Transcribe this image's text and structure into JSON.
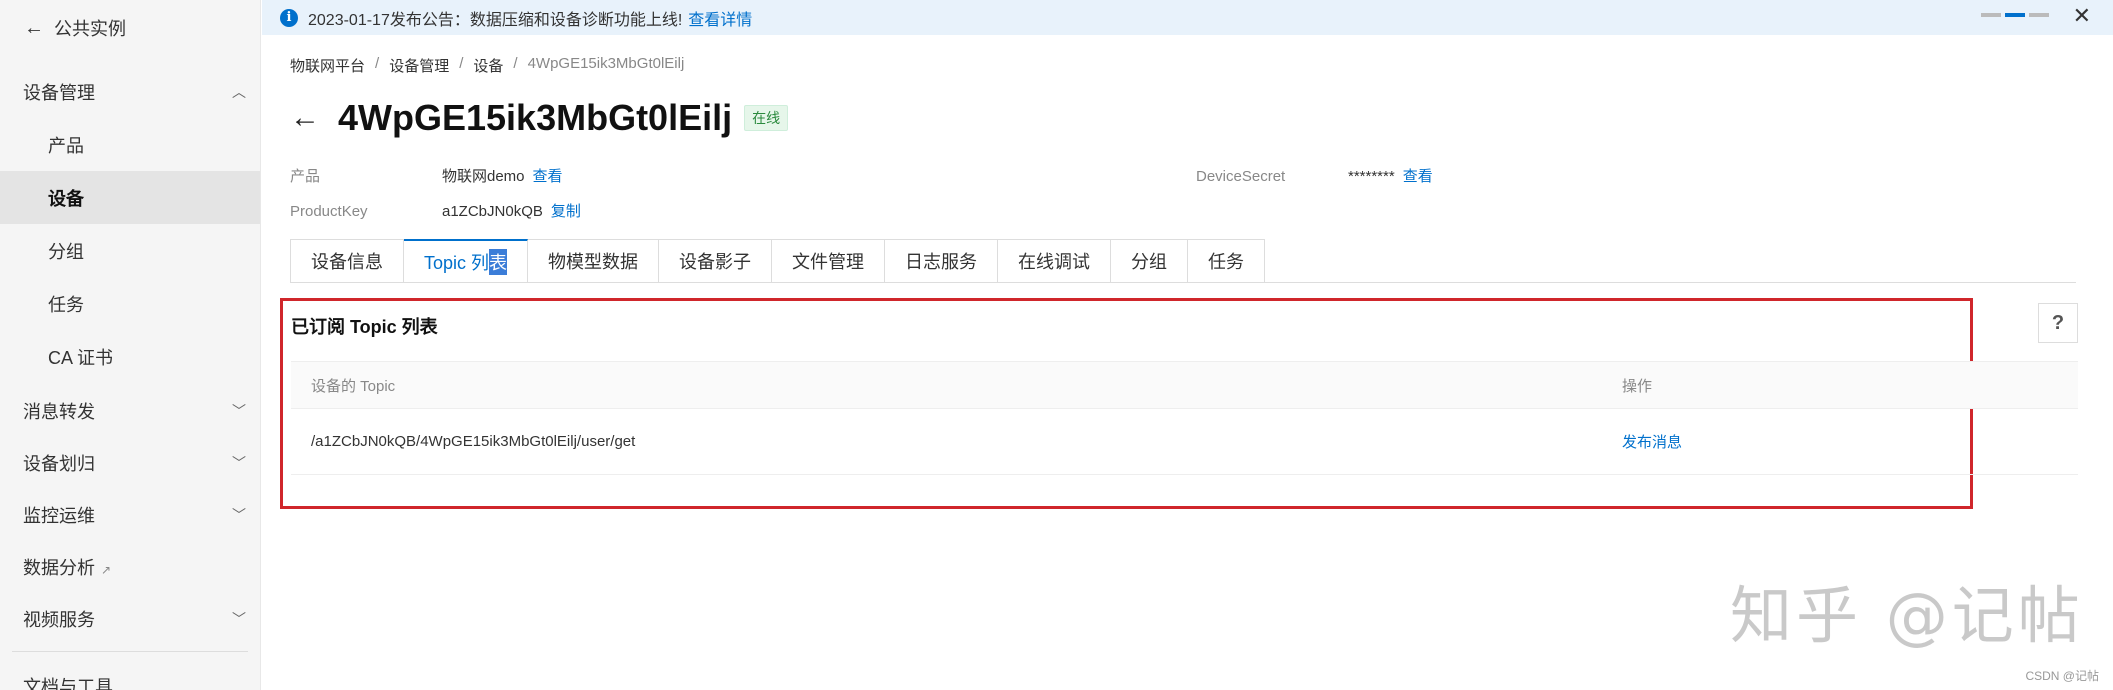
{
  "sidebar": {
    "back_label": "公共实例",
    "device_mgmt": "设备管理",
    "sub_items": [
      "产品",
      "设备",
      "分组",
      "任务",
      "CA 证书"
    ],
    "message_forward": "消息转发",
    "device_allocation": "设备划归",
    "monitoring": "监控运维",
    "data_analysis": "数据分析",
    "video_service": "视频服务",
    "docs_tools": "文档与工具"
  },
  "notice": {
    "text": "2023-01-17发布公告：数据压缩和设备诊断功能上线!",
    "link": "查看详情"
  },
  "breadcrumb": [
    "物联网平台",
    "设备管理",
    "设备",
    "4WpGE15ik3MbGt0lEilj"
  ],
  "device": {
    "name": "4WpGE15ik3MbGt0lEilj",
    "status": "在线",
    "product_label": "产品",
    "product_value": "物联网demo",
    "product_link": "查看",
    "productkey_label": "ProductKey",
    "productkey_value": "a1ZCbJN0kQB",
    "productkey_link": "复制",
    "secret_label": "DeviceSecret",
    "secret_value": "********",
    "secret_link": "查看"
  },
  "tabs": [
    "设备信息",
    "Topic 列",
    "表",
    "物模型数据",
    "设备影子",
    "文件管理",
    "日志服务",
    "在线调试",
    "分组",
    "任务"
  ],
  "section": {
    "title": "已订阅 Topic 列表",
    "help": "?",
    "col_topic": "设备的 Topic",
    "col_action": "操作",
    "rows": [
      {
        "topic": "/a1ZCbJN0kQB/4WpGE15ik3MbGt0lEilj/user/get",
        "action": "发布消息"
      }
    ]
  },
  "watermark": "知乎 @记帖",
  "csdn": "CSDN @记帖"
}
